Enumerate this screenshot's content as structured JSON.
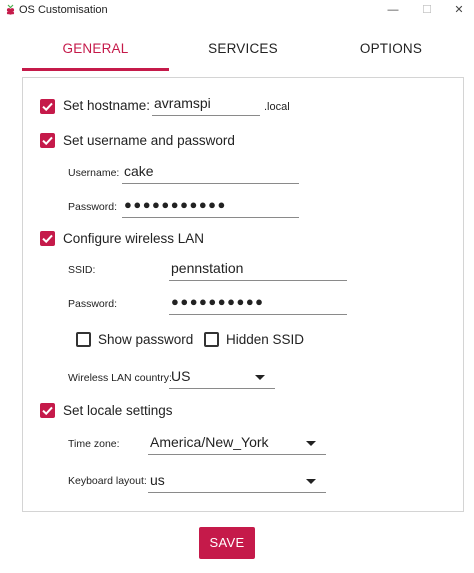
{
  "window": {
    "title": "OS Customisation",
    "min_glyph": "—",
    "max_glyph": "☐",
    "close_glyph": "✕"
  },
  "tabs": [
    {
      "label": "GENERAL"
    },
    {
      "label": "SERVICES"
    },
    {
      "label": "OPTIONS"
    }
  ],
  "general": {
    "hostname": {
      "label": "Set hostname:",
      "value": "avramspi",
      "suffix": ".local",
      "checked": true
    },
    "user": {
      "label": "Set username and password",
      "checked": true,
      "username_label": "Username:",
      "username_value": "cake",
      "password_label": "Password:",
      "password_value": "●●●●●●●●●●●"
    },
    "wlan": {
      "label": "Configure wireless LAN",
      "checked": true,
      "ssid_label": "SSID:",
      "ssid_value": "pennstation",
      "password_label": "Password:",
      "password_value": "●●●●●●●●●●",
      "show_password_label": "Show password",
      "show_password_checked": false,
      "hidden_ssid_label": "Hidden SSID",
      "hidden_ssid_checked": false,
      "country_label": "Wireless LAN country:",
      "country_value": "US"
    },
    "locale": {
      "label": "Set locale settings",
      "checked": true,
      "timezone_label": "Time zone:",
      "timezone_value": "America/New_York",
      "keyboard_label": "Keyboard layout:",
      "keyboard_value": "us"
    }
  },
  "save_label": "SAVE",
  "colors": {
    "accent": "#c51a4a",
    "border": "#d4d4d4"
  },
  "icons": [
    "raspberry-pi-icon",
    "checkmark-icon",
    "dropdown-caret-icon"
  ]
}
